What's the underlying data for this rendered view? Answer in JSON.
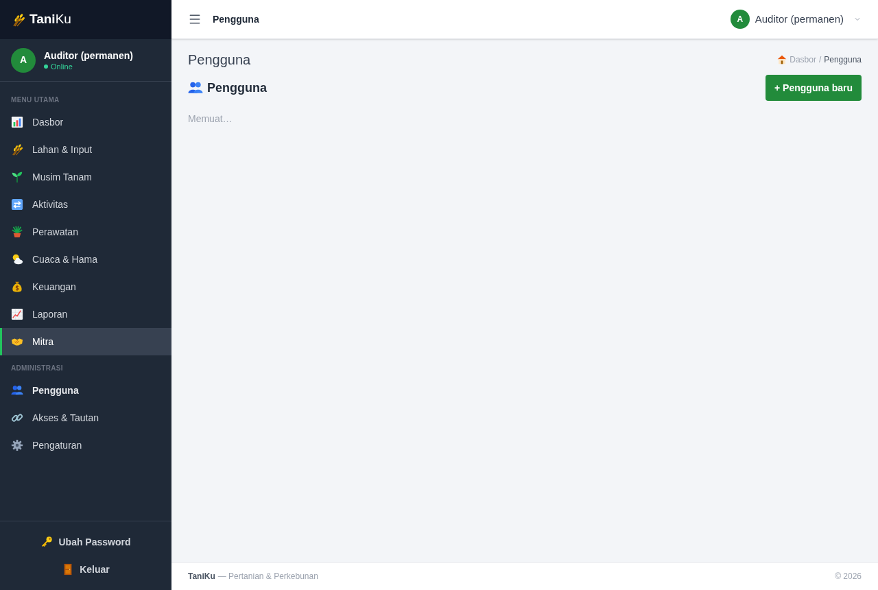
{
  "sidebar": {
    "logo": "**Tani**Ku",
    "user": {
      "avatar": "A",
      "name": "Auditor (permanen)",
      "status": "Online"
    },
    "sections": [
      {
        "title": "MENU UTAMA",
        "items": [
          {
            "label": "Dasbor",
            "selected": false,
            "current": false
          },
          {
            "label": "Lahan & Input",
            "selected": false,
            "current": false
          },
          {
            "label": "Musim Tanam",
            "selected": false,
            "current": false
          },
          {
            "label": "Aktivitas",
            "selected": false,
            "current": false
          },
          {
            "label": "Perawatan",
            "selected": false,
            "current": false
          },
          {
            "label": "Cuaca & Hama",
            "selected": false,
            "current": false
          },
          {
            "label": "Keuangan",
            "selected": false,
            "current": false
          },
          {
            "label": "Laporan",
            "selected": false,
            "current": false
          },
          {
            "label": "Mitra",
            "selected": true,
            "current": false
          }
        ]
      },
      {
        "title": "ADMINISTRASI",
        "items": [
          {
            "label": "Pengguna",
            "selected": false,
            "current": true
          },
          {
            "label": "Akses & Tautan",
            "selected": false,
            "current": false
          },
          {
            "label": "Pengaturan",
            "selected": false,
            "current": false
          }
        ]
      }
    ],
    "bottom_links": [
      {
        "kind": "password",
        "label": "Ubah Password"
      },
      {
        "kind": "logout",
        "label": "Keluar"
      }
    ]
  },
  "topbar": {
    "title": "Pengguna",
    "user": {
      "avatar": "A",
      "name": "Auditor (permanen)"
    }
  },
  "page": {
    "title": "Pengguna",
    "breadcrumb": [
      {
        "label": "Dasbor",
        "current": false
      },
      {
        "label": "Pengguna",
        "current": true
      }
    ],
    "breadcrumb_separator": "/",
    "heading": "Pengguna",
    "add_button": "+ Pengguna baru",
    "loading_text": "Memuat…"
  },
  "footer": {
    "brand": "TaniKu",
    "tagline": "— Pertanian & Perkebunan",
    "copyright": "© 2026"
  }
}
